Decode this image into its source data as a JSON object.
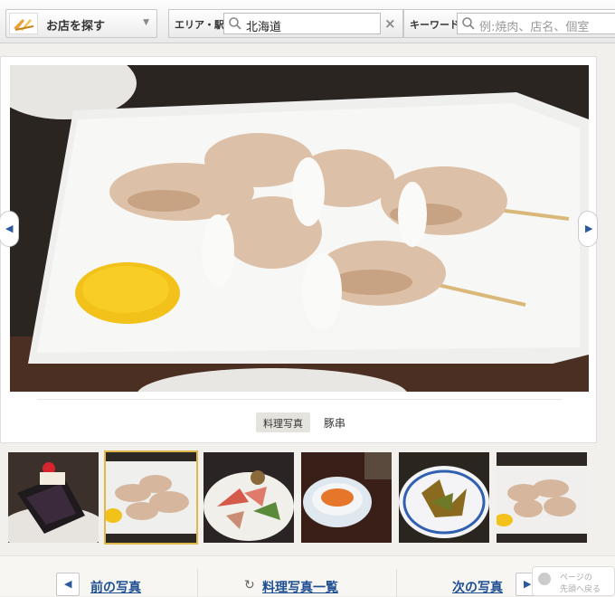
{
  "search": {
    "find_shop_label": "お店を探す",
    "area_label": "エリア・駅",
    "area_value": "北海道",
    "clear_symbol": "×",
    "keyword_label": "キーワード",
    "keyword_placeholder": "例:焼肉、店名、個室"
  },
  "photo": {
    "prev_arrow": "◀",
    "next_arrow": "▶",
    "category": "料理写真",
    "dish_name": "豚串"
  },
  "footer": {
    "prev_label": "前の写真",
    "list_label": "料理写真一覧",
    "next_label": "次の写真",
    "prev_arrow": "◀",
    "next_arrow": "▶",
    "refresh_icon": "↻",
    "to_top_line1": "ページの",
    "to_top_line2": "先頭へ戻る"
  },
  "colors": {
    "link": "#1f4f93",
    "selected_thumb_border": "#e0b74a"
  }
}
